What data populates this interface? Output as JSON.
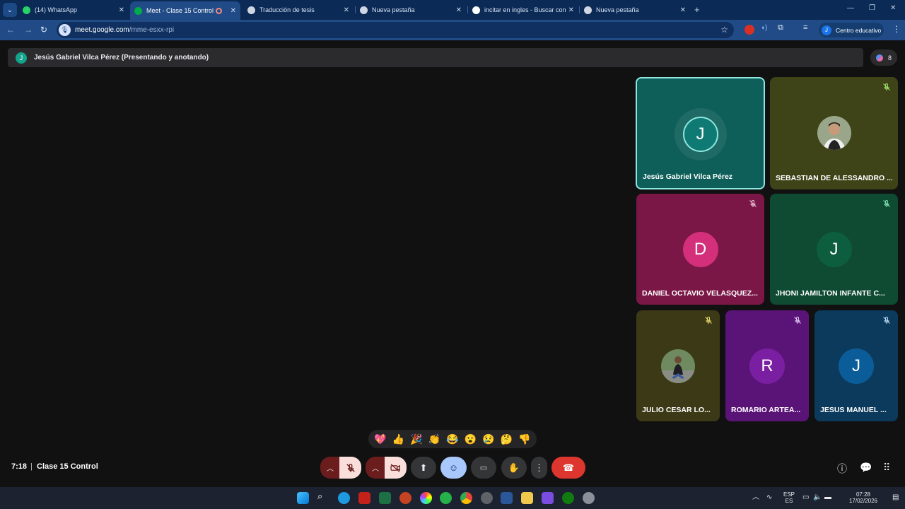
{
  "browser": {
    "tabs": [
      {
        "label": "(14) WhatsApp",
        "favicon_color": "#25d366"
      },
      {
        "label": "Meet - Clase 15 Control",
        "favicon_color": "#00ac47",
        "active": true
      },
      {
        "label": "Traducción de tesis",
        "favicon_color": "#d0d7e3"
      },
      {
        "label": "Nueva pestaña",
        "favicon_color": "#d0d7e3"
      },
      {
        "label": "incitar en ingles - Buscar con G",
        "favicon_color": "#ffffff"
      },
      {
        "label": "Nueva pestaña",
        "favicon_color": "#d0d7e3"
      }
    ],
    "new_tab": "+",
    "url_host": "meet.google.com",
    "url_path": "/mme-esxx-rpi",
    "profile_initial": "J",
    "profile_label": "Centro educativo"
  },
  "presenter": {
    "initial": "J",
    "text": "Jesús Gabriel Vilca Pérez (Presentando y anotando)"
  },
  "participants_count": "8",
  "tiles": [
    {
      "name": "Jesús Gabriel Vilca Pérez",
      "initial": "J",
      "bg": "#0e5e59",
      "avatar_bg": "#0f7a73",
      "speaking": true,
      "muted": false
    },
    {
      "name": "SEBASTIAN DE ALESSANDRO ...",
      "initial": "",
      "bg": "#3e4418",
      "photo": true,
      "muted": true
    },
    {
      "name": "DANIEL OCTAVIO VELASQUEZ...",
      "initial": "D",
      "bg": "#7a1746",
      "avatar_bg": "#d32f7b",
      "muted": true
    },
    {
      "name": "JHONI JAMILTON INFANTE C...",
      "initial": "J",
      "bg": "#0f4a32",
      "avatar_bg": "#0d5e3f",
      "muted": true
    },
    {
      "name": "JULIO CESAR LO...",
      "initial": "",
      "bg": "#3c3a16",
      "photo": true,
      "muted": true
    },
    {
      "name": "ROMARIO ARTEA...",
      "initial": "R",
      "bg": "#5a1477",
      "avatar_bg": "#7a1fa2",
      "muted": true
    },
    {
      "name": "JESUS MANUEL ...",
      "initial": "J",
      "bg": "#0c3a5c",
      "avatar_bg": "#0b5d9a",
      "muted": true
    }
  ],
  "reactions": [
    "💖",
    "👍",
    "🎉",
    "👏",
    "😂",
    "😮",
    "😢",
    "🤔",
    "👎"
  ],
  "meeting": {
    "time": "7:18",
    "separator": "|",
    "title": "Clase 15 Control"
  },
  "taskbar": {
    "lang_top": "ESP",
    "lang_bottom": "ES",
    "clock_time": "07:28",
    "clock_date": "17/02/2026"
  }
}
